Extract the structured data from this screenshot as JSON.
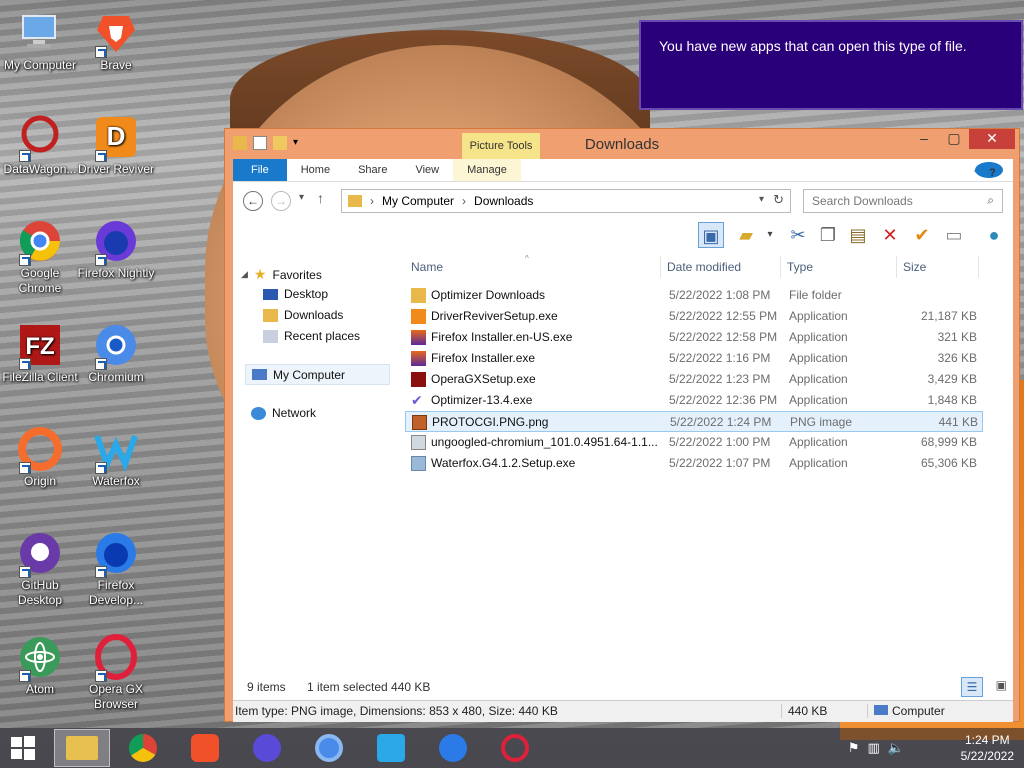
{
  "desktop": {
    "icons": [
      {
        "label": "My Computer"
      },
      {
        "label": "Brave"
      },
      {
        "label": "DataWagon..."
      },
      {
        "label": "Driver Reviver"
      },
      {
        "label": "Google Chrome"
      },
      {
        "label": "Firefox Nightly"
      },
      {
        "label": "FileZilla Client"
      },
      {
        "label": "Chromium"
      },
      {
        "label": "Origin"
      },
      {
        "label": "Waterfox"
      },
      {
        "label": "GitHub Desktop"
      },
      {
        "label": "Firefox Develop..."
      },
      {
        "label": "Atom"
      },
      {
        "label": "Opera GX Browser"
      }
    ]
  },
  "notification": {
    "text": "You have new apps that can open this type of file."
  },
  "window": {
    "title": "Downloads",
    "context_tab": "Picture Tools",
    "tabs": {
      "file": "File",
      "home": "Home",
      "share": "Share",
      "view": "View",
      "manage": "Manage"
    },
    "help": "?",
    "address": {
      "root": "My Computer",
      "folder": "Downloads"
    },
    "search_placeholder": "Search Downloads",
    "nav": {
      "favorites": "Favorites",
      "desktop": "Desktop",
      "downloads": "Downloads",
      "recent": "Recent places",
      "my_computer": "My Computer",
      "network": "Network"
    },
    "columns": {
      "name": "Name",
      "date": "Date modified",
      "type": "Type",
      "size": "Size"
    },
    "files": [
      {
        "name": "Optimizer Downloads",
        "date": "5/22/2022 1:08 PM",
        "type": "File folder",
        "size": ""
      },
      {
        "name": "DriverReviverSetup.exe",
        "date": "5/22/2022 12:55 PM",
        "type": "Application",
        "size": "21,187 KB"
      },
      {
        "name": "Firefox Installer.en-US.exe",
        "date": "5/22/2022 12:58 PM",
        "type": "Application",
        "size": "321 KB"
      },
      {
        "name": "Firefox Installer.exe",
        "date": "5/22/2022 1:16 PM",
        "type": "Application",
        "size": "326 KB"
      },
      {
        "name": "OperaGXSetup.exe",
        "date": "5/22/2022 1:23 PM",
        "type": "Application",
        "size": "3,429 KB"
      },
      {
        "name": "Optimizer-13.4.exe",
        "date": "5/22/2022 12:36 PM",
        "type": "Application",
        "size": "1,848 KB"
      },
      {
        "name": "PROTOCGI.PNG.png",
        "date": "5/22/2022 1:24 PM",
        "type": "PNG image",
        "size": "441 KB"
      },
      {
        "name": "ungoogled-chromium_101.0.4951.64-1.1...",
        "date": "5/22/2022 1:00 PM",
        "type": "Application",
        "size": "68,999 KB"
      },
      {
        "name": "Waterfox.G4.1.2.Setup.exe",
        "date": "5/22/2022 1:07 PM",
        "type": "Application",
        "size": "65,306 KB"
      }
    ],
    "status": {
      "items": "9 items",
      "selected": "1 item selected  440 KB"
    },
    "details": {
      "info": "Item type: PNG image, Dimensions: 853 x 480, Size: 440 KB",
      "size": "440 KB",
      "location": "Computer"
    }
  },
  "taskbar": {
    "time": "1:24 PM",
    "date": "5/22/2022"
  },
  "colors": {
    "accent": "#1979ca",
    "window_frame": "#f0a070",
    "notification": "#2a007a",
    "selection": "#e4f1fc"
  }
}
